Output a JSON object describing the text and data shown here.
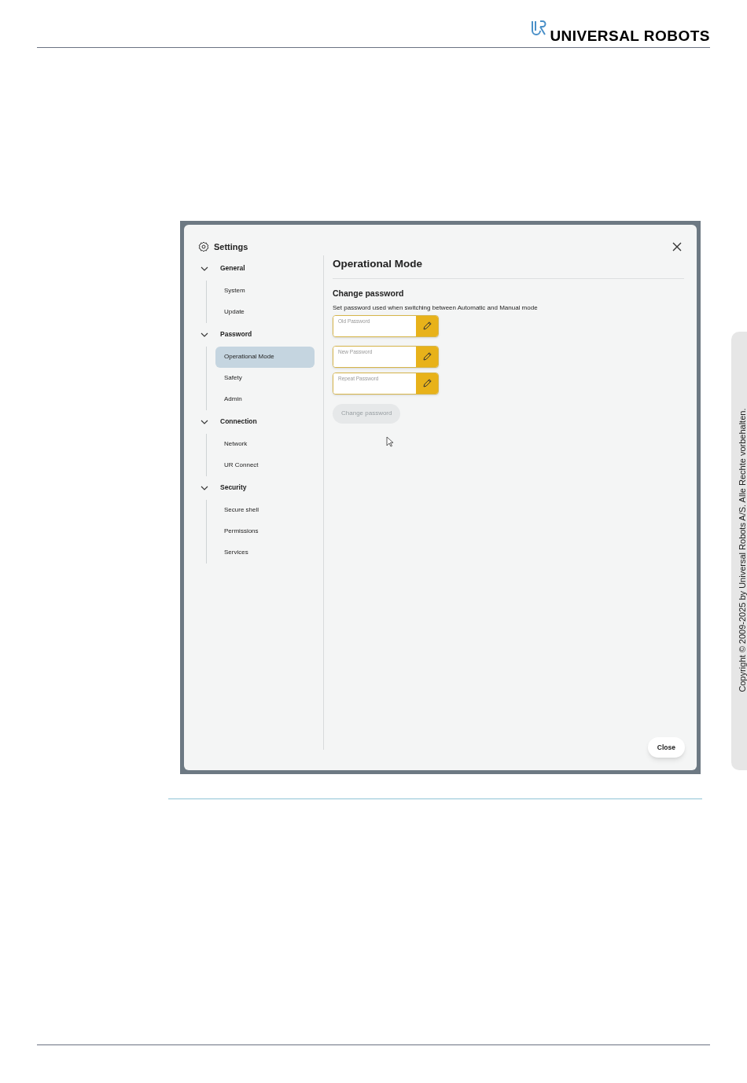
{
  "header": {
    "logo_text": "UNIVERSAL ROBOTS"
  },
  "dialog": {
    "title": "Settings",
    "nav": [
      {
        "label": "General",
        "expanded": true,
        "children": [
          {
            "label": "System",
            "selected": false
          },
          {
            "label": "Update",
            "selected": false
          }
        ]
      },
      {
        "label": "Password",
        "expanded": true,
        "children": [
          {
            "label": "Operational Mode",
            "selected": true
          },
          {
            "label": "Safety",
            "selected": false
          },
          {
            "label": "Admin",
            "selected": false
          }
        ]
      },
      {
        "label": "Connection",
        "expanded": true,
        "children": [
          {
            "label": "Network",
            "selected": false
          },
          {
            "label": "UR Connect",
            "selected": false
          }
        ]
      },
      {
        "label": "Security",
        "expanded": true,
        "children": [
          {
            "label": "Secure shell",
            "selected": false
          },
          {
            "label": "Permissions",
            "selected": false
          },
          {
            "label": "Services",
            "selected": false
          }
        ]
      }
    ],
    "page_title": "Operational Mode",
    "section_title": "Change password",
    "description": "Set password used when switching between Automatic and Manual mode",
    "fields": [
      {
        "placeholder": "Old Password"
      },
      {
        "placeholder": "New Password"
      },
      {
        "placeholder": "Repeat Password"
      }
    ],
    "submit_button": {
      "label": "Change password",
      "disabled": true
    },
    "close_button": "Close"
  },
  "side_note": "Copyright © 2009-2025 by Universal Robots A/S. Alle Rechte vorbehalten."
}
